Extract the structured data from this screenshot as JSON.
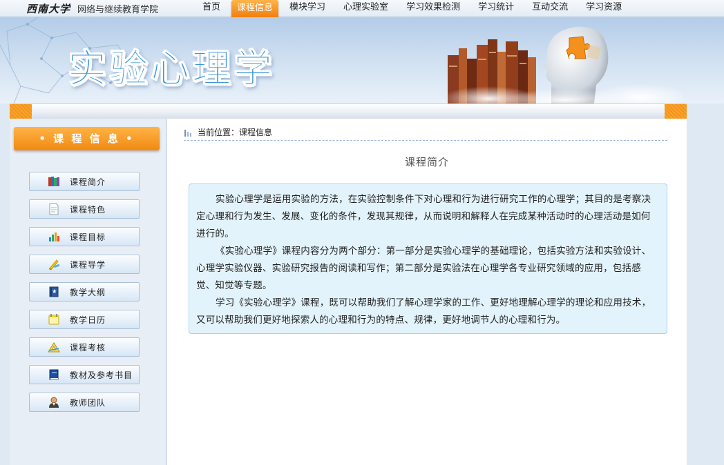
{
  "header": {
    "school_name": "西南大学",
    "college_name": "网络与继续教育学院"
  },
  "nav": {
    "items": [
      "首页",
      "课程信息",
      "模块学习",
      "心理实验室",
      "学习效果检测",
      "学习统计",
      "互动交流",
      "学习资源"
    ],
    "active_index": 1
  },
  "banner": {
    "title": "实验心理学"
  },
  "sidebar": {
    "title": "• 课 程 信 息 •",
    "items": [
      {
        "label": "课程简介",
        "icon": "books-icon"
      },
      {
        "label": "课程特色",
        "icon": "document-icon"
      },
      {
        "label": "课程目标",
        "icon": "bar-chart-icon"
      },
      {
        "label": "课程导学",
        "icon": "pencil-ruler-icon"
      },
      {
        "label": "教学大纲",
        "icon": "blue-book-icon"
      },
      {
        "label": "教学日历",
        "icon": "calendar-note-icon"
      },
      {
        "label": "课程考核",
        "icon": "triangle-ruler-icon"
      },
      {
        "label": "教材及参考书目",
        "icon": "textbook-icon"
      },
      {
        "label": "教师团队",
        "icon": "teacher-icon"
      }
    ]
  },
  "breadcrumb": {
    "label": "当前位置：课程信息"
  },
  "main": {
    "section_title": "课程简介",
    "paragraphs": [
      "实验心理学是运用实验的方法，在实验控制条件下对心理和行为进行研究工作的心理学；其目的是考察决定心理和行为发生、发展、变化的条件，发现其规律，从而说明和解释人在完成某种活动时的心理活动是如何进行的。",
      "《实验心理学》课程内容分为两个部分：第一部分是实验心理学的基础理论，包括实验方法和实验设计、心理学实验仪器、实验研究报告的阅读和写作；第二部分是实验法在心理学各专业研究领域的应用，包括感觉、知觉等专题。",
      "学习《实验心理学》课程，既可以帮助我们了解心理学家的工作、更好地理解心理学的理论和应用技术，又可以帮助我们更好地探索人的心理和行为的特点、规律，更好地调节人的心理和行为。"
    ]
  }
}
